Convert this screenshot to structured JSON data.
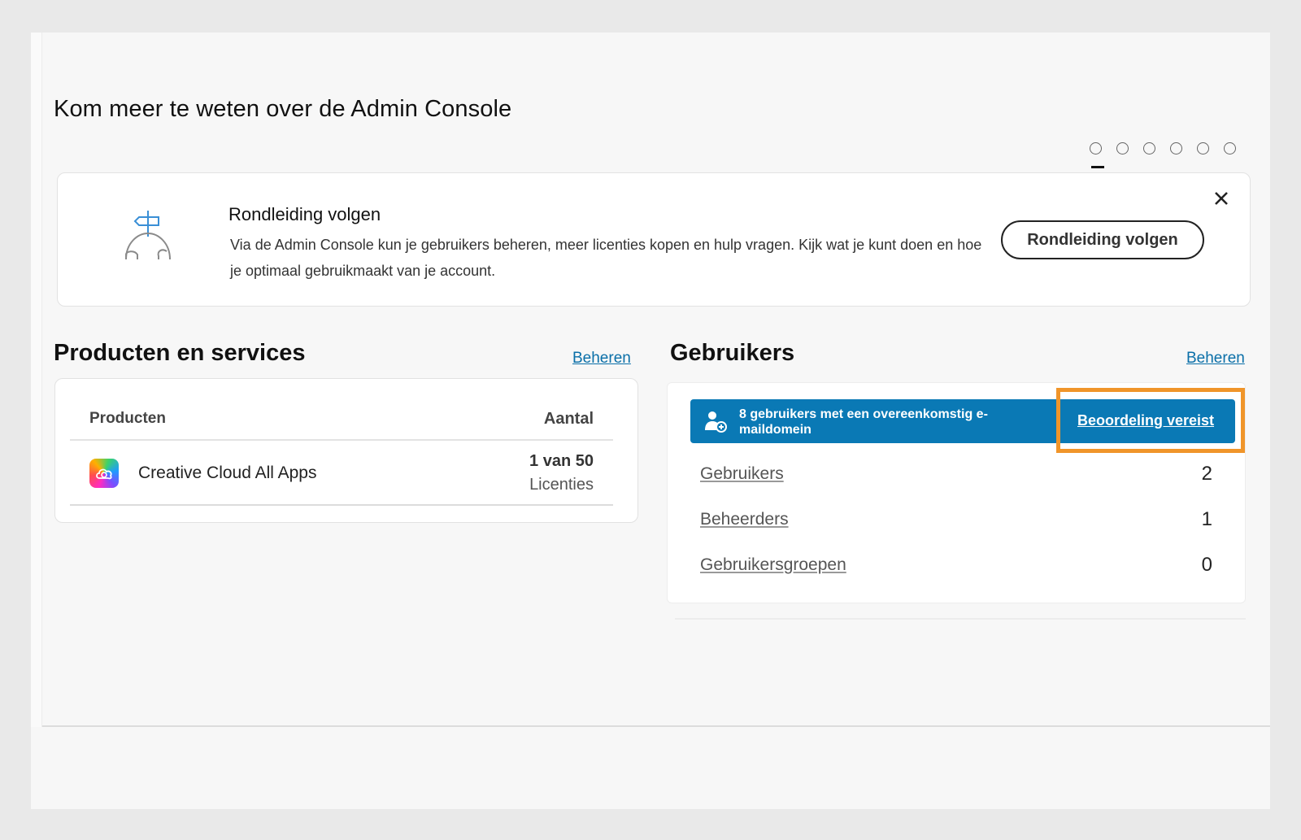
{
  "learn": {
    "title": "Kom meer te weten over de Admin Console",
    "carousel_total": 6,
    "carousel_active": 1
  },
  "tour": {
    "heading": "Rondleiding volgen",
    "body": "Via de Admin Console kun je gebruikers beheren, meer licenties kopen en hulp vragen. Kijk wat je kunt doen en hoe je optimaal gebruikmaakt van je account.",
    "button_label": "Rondleiding volgen",
    "illustration_icon": "signpost-icon",
    "close_icon": "close-icon"
  },
  "products": {
    "title": "Producten en services",
    "manage_label": "Beheren",
    "columns": {
      "products": "Producten",
      "amount": "Aantal"
    },
    "rows": [
      {
        "name": "Creative Cloud All Apps",
        "qty": "1 van 50",
        "unit": "Licenties",
        "icon": "creative-cloud-icon"
      }
    ]
  },
  "users": {
    "title": "Gebruikers",
    "manage_label": "Beheren",
    "banner": {
      "text": "8 gebruikers met een overeenkomstig e-maildomein",
      "action_label": "Beoordeling vereist",
      "icon": "add-user-icon",
      "color": "#0a79b5"
    },
    "rows": [
      {
        "label": "Gebruikers",
        "count": "2"
      },
      {
        "label": "Beheerders",
        "count": "1"
      },
      {
        "label": "Gebruikersgroepen",
        "count": "0"
      }
    ]
  },
  "colors": {
    "link": "#0a6fa8",
    "highlight": "#f0952a"
  }
}
